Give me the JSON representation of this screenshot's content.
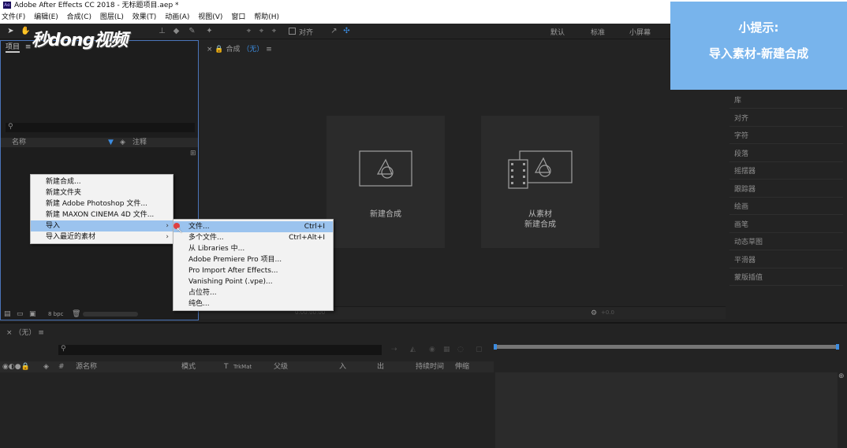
{
  "window": {
    "title": "Adobe After Effects CC 2018 - 无标题项目.aep *",
    "logo": "Ae"
  },
  "menubar": [
    "文件(F)",
    "编辑(E)",
    "合成(C)",
    "图层(L)",
    "效果(T)",
    "动画(A)",
    "视图(V)",
    "窗口",
    "帮助(H)"
  ],
  "toolbar": {
    "align_label": "对齐",
    "workspaces": [
      "默认",
      "标准",
      "小屏幕"
    ]
  },
  "watermark": "秒dong视频",
  "tip": {
    "title": "小提示:",
    "text": "导入素材-新建合成"
  },
  "project_panel": {
    "tab": "项目",
    "columns": {
      "name": "名称",
      "comment": "注释"
    },
    "bpc": "8 bpc"
  },
  "comp_panel": {
    "tab": "合成",
    "tab_value": "（无）",
    "new_comp_label": "新建合成",
    "from_footage_line1": "从素材",
    "from_footage_line2": "新建合成",
    "footer_time": "0:00:00:00",
    "footer_exposure": "+0.0"
  },
  "right_panel": [
    "库",
    "对齐",
    "字符",
    "段落",
    "摇摆器",
    "跟踪器",
    "绘画",
    "画笔",
    "动态草图",
    "平滑器",
    "蒙版插值"
  ],
  "timeline": {
    "tab": "（无）",
    "columns": {
      "source_name": "源名称",
      "mode": "模式",
      "t": "T",
      "trkmat": "TrkMat",
      "parent": "父级",
      "in": "入",
      "out": "出",
      "duration": "持续时间",
      "stretch": "伸缩"
    }
  },
  "context_menu": {
    "items": [
      {
        "label": "新建合成..."
      },
      {
        "label": "新建文件夹"
      },
      {
        "label": "新建 Adobe Photoshop 文件..."
      },
      {
        "label": "新建 MAXON CINEMA 4D 文件..."
      },
      {
        "label": "导入",
        "submenu": true
      },
      {
        "label": "导入最近的素材",
        "submenu": true
      }
    ]
  },
  "import_submenu": {
    "items": [
      {
        "label": "文件...",
        "shortcut": "Ctrl+I"
      },
      {
        "label": "多个文件...",
        "shortcut": "Ctrl+Alt+I"
      },
      {
        "label": "从 Libraries 中..."
      },
      {
        "label": "Adobe Premiere Pro 项目..."
      },
      {
        "label": "Pro Import After Effects..."
      },
      {
        "label": "Vanishing Point (.vpe)..."
      },
      {
        "label": "占位符..."
      },
      {
        "label": "纯色..."
      }
    ]
  },
  "colors": {
    "accent_blue": "#4a74b8",
    "tip_bg": "#78b4ec",
    "menu_highlight": "#9bc3ee",
    "timeline_marker": "#3c8ce0"
  }
}
